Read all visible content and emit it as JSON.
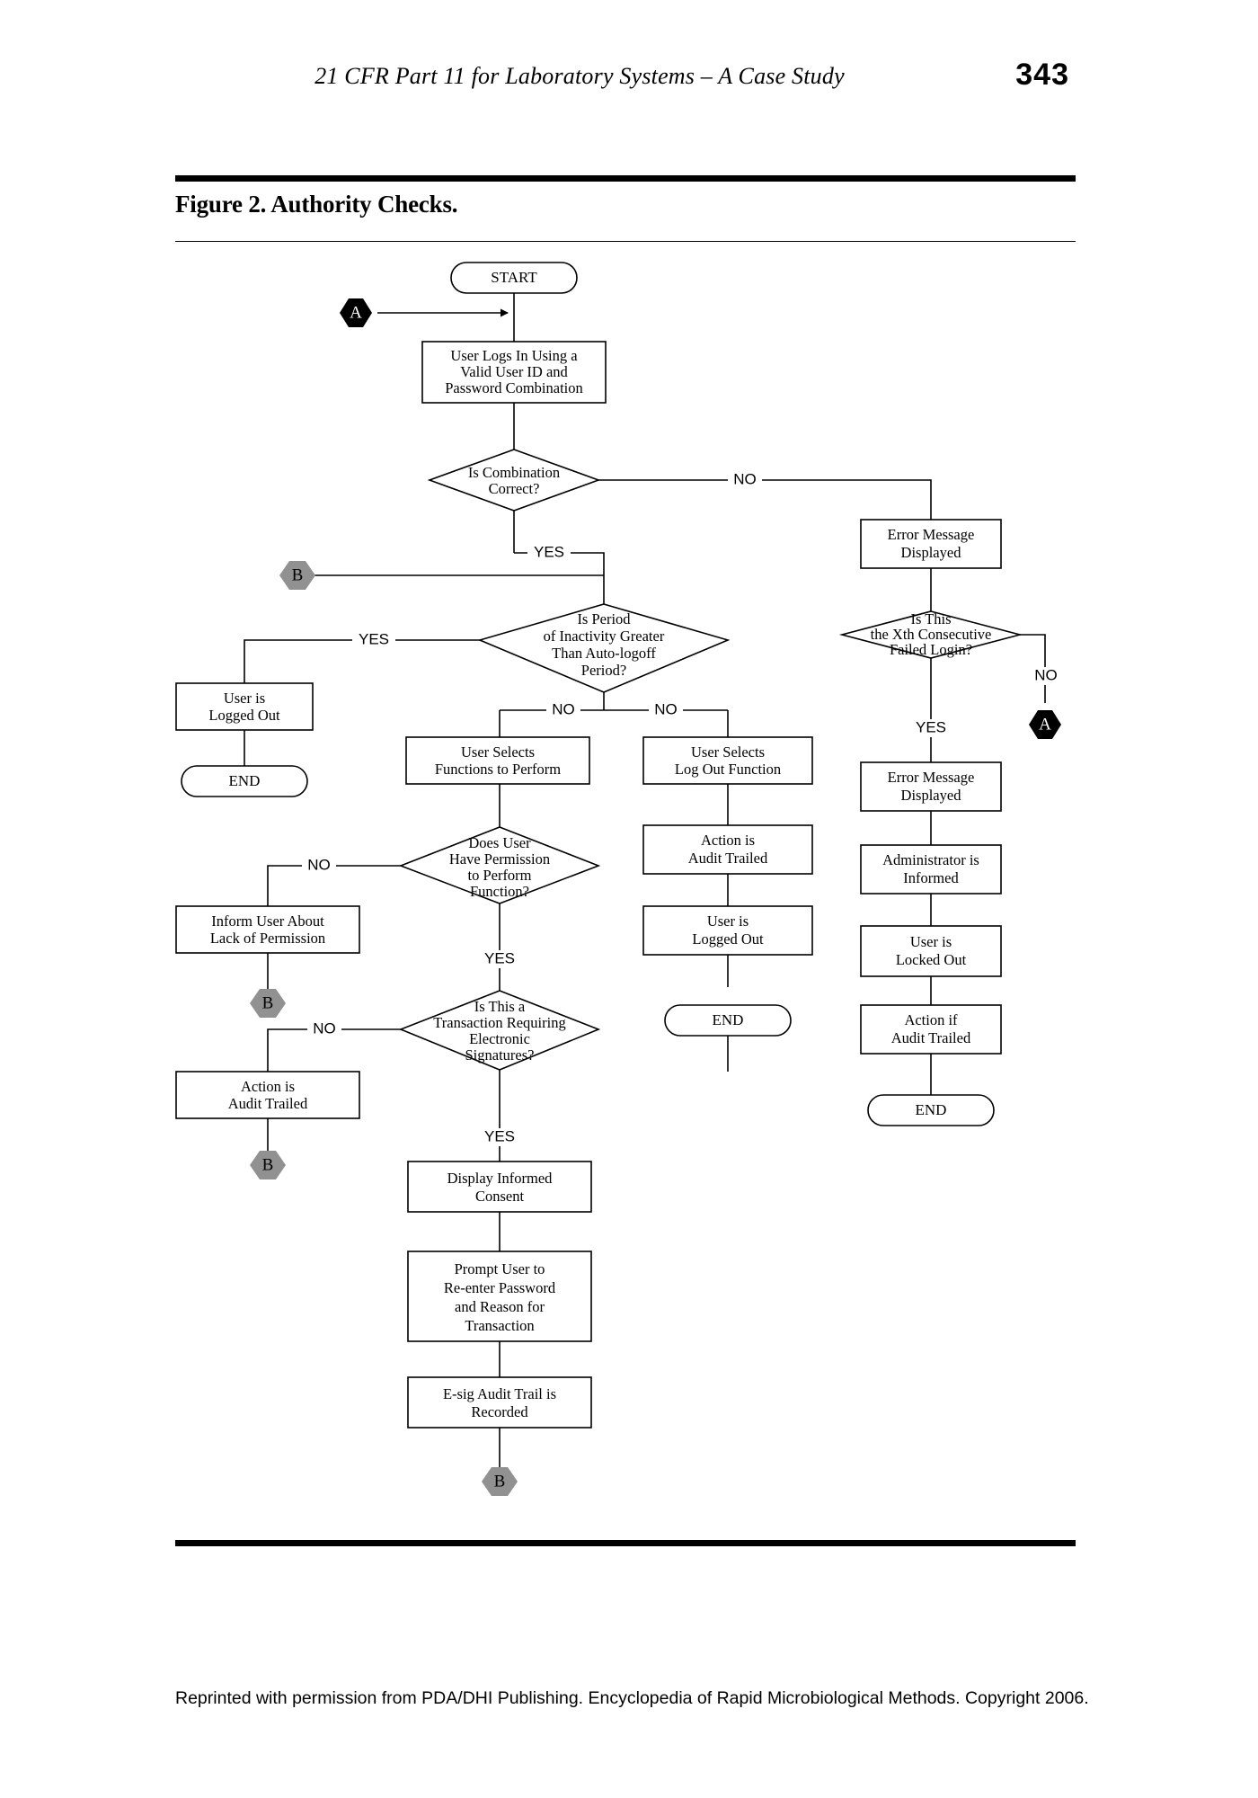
{
  "page": {
    "running_head": "21 CFR Part 11 for Laboratory Systems – A Case Study",
    "page_number": "343",
    "figure_caption": "Figure 2. Authority Checks.",
    "footer": "Reprinted with permission from PDA/DHI Publishing. Encyclopedia of Rapid Microbiological Methods. Copyright 2006."
  },
  "colors": {
    "connector_dark": "#000000",
    "connector_gray": "#919191",
    "shape_fill": "#ffffff",
    "stroke": "#000000"
  },
  "chart_data": {
    "type": "diagram",
    "title": "Figure 2. Authority Checks.",
    "nodes": {
      "start": {
        "label": "START",
        "shape": "terminator"
      },
      "conn_a_in": {
        "label": "A",
        "shape": "hexagon",
        "style": "dark"
      },
      "login": {
        "label": "User Logs In Using a\nValid User ID and\nPassword Combination",
        "shape": "process"
      },
      "d_combination": {
        "label": "Is Combination\nCorrect?",
        "shape": "decision"
      },
      "conn_b_in": {
        "label": "B",
        "shape": "hexagon",
        "style": "gray"
      },
      "err_msg_1": {
        "label": "Error Message\nDisplayed",
        "shape": "process"
      },
      "d_xth_login": {
        "label": "Is This\nthe Xth Consecutive\nFailed Login?",
        "shape": "decision"
      },
      "conn_a_out": {
        "label": "A",
        "shape": "hexagon",
        "style": "dark"
      },
      "err_msg_2": {
        "label": "Error Message\nDisplayed",
        "shape": "process"
      },
      "admin_informed": {
        "label": "Administrator is\nInformed",
        "shape": "process"
      },
      "user_locked_out": {
        "label": "User is\nLocked Out",
        "shape": "process"
      },
      "action_if_audit": {
        "label": "Action if\nAudit Trailed",
        "shape": "process"
      },
      "end_right": {
        "label": "END",
        "shape": "terminator"
      },
      "d_inactivity": {
        "label": "Is Period\nof Inactivity Greater\nThan Auto-logoff\nPeriod?",
        "shape": "decision"
      },
      "user_logged_out_left": {
        "label": "User is\nLogged Out",
        "shape": "process"
      },
      "end_left": {
        "label": "END",
        "shape": "terminator"
      },
      "select_functions": {
        "label": "User Selects\nFunctions to Perform",
        "shape": "process"
      },
      "select_logout": {
        "label": "User Selects\nLog Out Function",
        "shape": "process"
      },
      "action_audit_trailed_logout": {
        "label": "Action is\nAudit Trailed",
        "shape": "process"
      },
      "user_logged_out_mid": {
        "label": "User is\nLogged Out",
        "shape": "process"
      },
      "end_mid": {
        "label": "END",
        "shape": "terminator"
      },
      "d_permission": {
        "label": "Does User\nHave Permission\nto Perform\nFunction?",
        "shape": "decision"
      },
      "inform_lack_permission": {
        "label": "Inform User About\nLack of Permission",
        "shape": "process"
      },
      "conn_b_out_1": {
        "label": "B",
        "shape": "hexagon",
        "style": "gray"
      },
      "d_esig": {
        "label": "Is This a\nTransaction Requiring\nElectronic\nSignatures?",
        "shape": "decision"
      },
      "action_audit_trailed_noesig": {
        "label": "Action is\nAudit Trailed",
        "shape": "process"
      },
      "conn_b_out_2": {
        "label": "B",
        "shape": "hexagon",
        "style": "gray"
      },
      "display_consent": {
        "label": "Display Informed\nConsent",
        "shape": "process"
      },
      "prompt_reenter": {
        "label": "Prompt User to\nRe-enter Password\nand Reason for\nTransaction",
        "shape": "process"
      },
      "esig_audit_trail": {
        "label": "E-sig Audit Trail is\nRecorded",
        "shape": "process"
      },
      "conn_b_out_3": {
        "label": "B",
        "shape": "hexagon",
        "style": "gray"
      }
    },
    "edge_labels": {
      "combination_no": "NO",
      "combination_yes": "YES",
      "xth_login_yes": "YES",
      "xth_login_no": "NO",
      "inactivity_yes": "YES",
      "inactivity_no_left": "NO",
      "inactivity_no_right": "NO",
      "permission_no": "NO",
      "permission_yes": "YES",
      "esig_no": "NO",
      "esig_yes": "YES"
    },
    "edges": [
      {
        "from": "start",
        "to": "login"
      },
      {
        "from": "conn_a_in",
        "to": "login"
      },
      {
        "from": "login",
        "to": "d_combination"
      },
      {
        "from": "d_combination",
        "to": "err_msg_1",
        "label": "NO"
      },
      {
        "from": "d_combination",
        "to": "d_inactivity",
        "label": "YES"
      },
      {
        "from": "conn_b_in",
        "to": "d_inactivity"
      },
      {
        "from": "err_msg_1",
        "to": "d_xth_login"
      },
      {
        "from": "d_xth_login",
        "to": "conn_a_out",
        "label": "NO"
      },
      {
        "from": "d_xth_login",
        "to": "err_msg_2",
        "label": "YES"
      },
      {
        "from": "err_msg_2",
        "to": "admin_informed"
      },
      {
        "from": "admin_informed",
        "to": "user_locked_out"
      },
      {
        "from": "user_locked_out",
        "to": "action_if_audit"
      },
      {
        "from": "action_if_audit",
        "to": "end_right"
      },
      {
        "from": "d_inactivity",
        "to": "user_logged_out_left",
        "label": "YES"
      },
      {
        "from": "user_logged_out_left",
        "to": "end_left"
      },
      {
        "from": "d_inactivity",
        "to": "select_functions",
        "label": "NO"
      },
      {
        "from": "d_inactivity",
        "to": "select_logout",
        "label": "NO"
      },
      {
        "from": "select_logout",
        "to": "action_audit_trailed_logout"
      },
      {
        "from": "action_audit_trailed_logout",
        "to": "user_logged_out_mid"
      },
      {
        "from": "user_logged_out_mid",
        "to": "end_mid"
      },
      {
        "from": "select_functions",
        "to": "d_permission"
      },
      {
        "from": "d_permission",
        "to": "inform_lack_permission",
        "label": "NO"
      },
      {
        "from": "inform_lack_permission",
        "to": "conn_b_out_1"
      },
      {
        "from": "d_permission",
        "to": "d_esig",
        "label": "YES"
      },
      {
        "from": "d_esig",
        "to": "action_audit_trailed_noesig",
        "label": "NO"
      },
      {
        "from": "action_audit_trailed_noesig",
        "to": "conn_b_out_2"
      },
      {
        "from": "d_esig",
        "to": "display_consent",
        "label": "YES"
      },
      {
        "from": "display_consent",
        "to": "prompt_reenter"
      },
      {
        "from": "prompt_reenter",
        "to": "esig_audit_trail"
      },
      {
        "from": "esig_audit_trail",
        "to": "conn_b_out_3"
      }
    ]
  }
}
